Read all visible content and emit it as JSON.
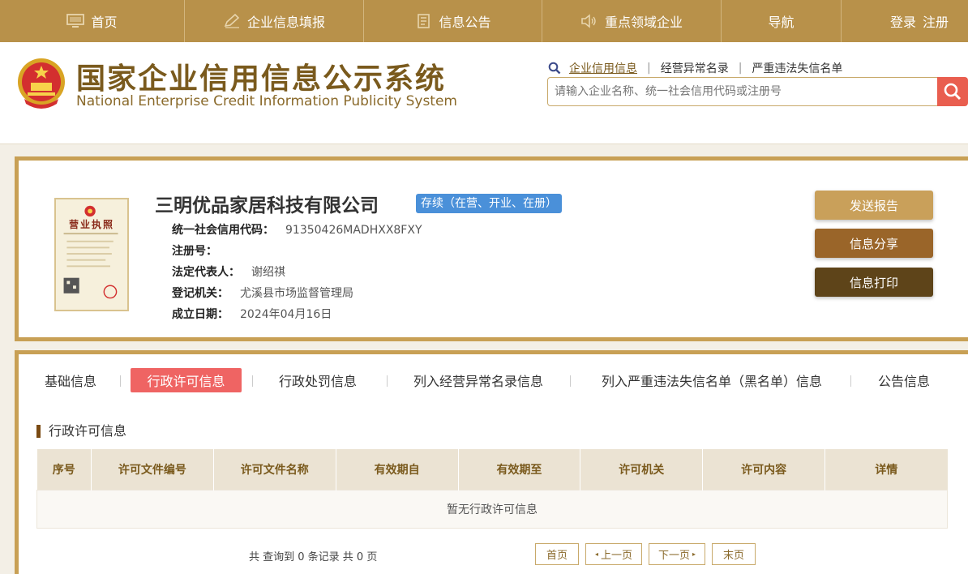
{
  "topnav": {
    "home": "首页",
    "fill": "企业信息填报",
    "notice": "信息公告",
    "key": "重点领域企业",
    "nav": "导航",
    "login": "登录",
    "register": "注册"
  },
  "header": {
    "title_cn": "国家企业信用信息公示系统",
    "title_en": "National Enterprise Credit Information Publicity System",
    "links": [
      "企业信用信息",
      "经营异常名录",
      "严重违法失信名单"
    ],
    "search_placeholder": "请输入企业名称、统一社会信用代码或注册号"
  },
  "company": {
    "name": "三明优品家居科技有限公司",
    "status": "存续（在营、开业、在册）",
    "license_title": "营业执照",
    "fields": [
      {
        "label": "统一社会信用代码：",
        "value": "91350426MADHXX8FXY"
      },
      {
        "label": "注册号：",
        "value": ""
      },
      {
        "label": "法定代表人：",
        "value": "谢绍祺"
      },
      {
        "label": "登记机关：",
        "value": "尤溪县市场监督管理局"
      },
      {
        "label": "成立日期：",
        "value": "2024年04月16日"
      }
    ],
    "actions": [
      "发送报告",
      "信息分享",
      "信息打印"
    ]
  },
  "tabs": [
    "基础信息",
    "行政许可信息",
    "行政处罚信息",
    "列入经营异常名录信息",
    "列入严重违法失信名单（黑名单）信息",
    "公告信息"
  ],
  "section": {
    "title": "行政许可信息",
    "columns": [
      "序号",
      "许可文件编号",
      "许可文件名称",
      "有效期自",
      "有效期至",
      "许可机关",
      "许可内容",
      "详情"
    ],
    "empty": "暂无行政许可信息",
    "pager_info": "共 查询到 0 条记录 共 0 页",
    "pager": [
      "首页",
      "上一页",
      "下一页",
      "末页"
    ]
  },
  "colors": {
    "nav_bg": "#b8914a",
    "accent": "#c8a055",
    "status": "#4a90d9",
    "active_tab": "#ef6463",
    "btn_report": "#c9a05a",
    "btn_share": "#9a6529",
    "btn_print": "#5e4419"
  }
}
